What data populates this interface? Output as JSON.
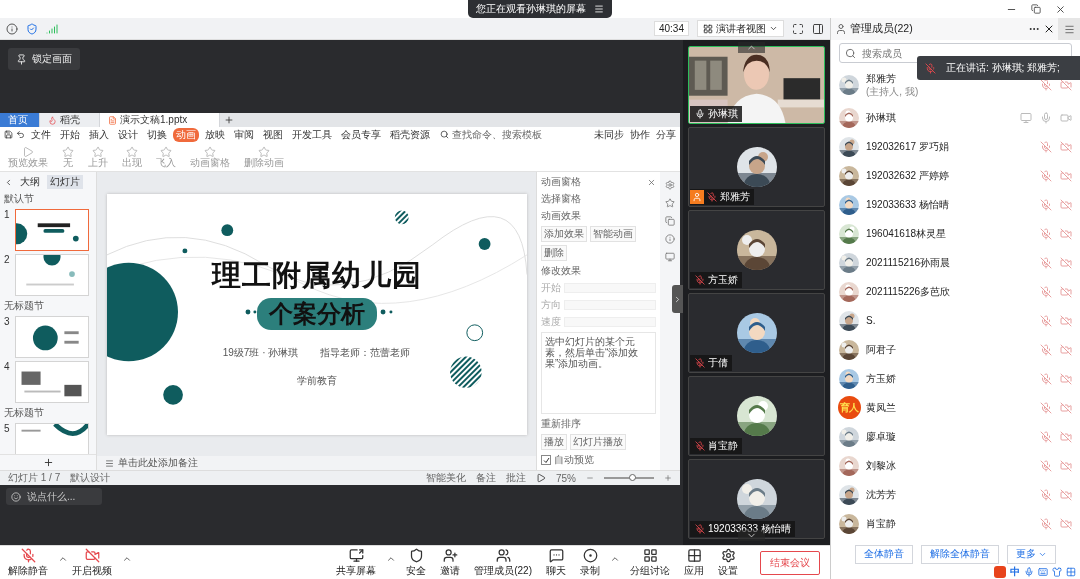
{
  "top_bar": {
    "title": "您正在观看孙琳琪的屏幕"
  },
  "meeting_bar": {
    "timer": "40:34",
    "view": "演讲者视图"
  },
  "lock_button": "锁定画面",
  "wps": {
    "tabs": [
      {
        "label": "首页",
        "kind": "home",
        "selected": false
      },
      {
        "label": "稻壳",
        "kind": "docer",
        "selected": false
      },
      {
        "label": "演示文稿1.pptx",
        "kind": "file",
        "selected": true
      }
    ],
    "menu": [
      {
        "label": "文件",
        "selected": false
      },
      {
        "label": "开始",
        "selected": false
      },
      {
        "label": "插入",
        "selected": false
      },
      {
        "label": "设计",
        "selected": false
      },
      {
        "label": "切换",
        "selected": false
      },
      {
        "label": "动画",
        "selected": true
      },
      {
        "label": "放映",
        "selected": false
      },
      {
        "label": "审阅",
        "selected": false
      },
      {
        "label": "视图",
        "selected": false
      },
      {
        "label": "开发工具",
        "selected": false
      },
      {
        "label": "会员专享",
        "selected": false
      },
      {
        "label": "稻壳资源",
        "selected": false
      }
    ],
    "search": "查找命令、搜索模板",
    "menu_actions": [
      "未同步",
      "协作",
      "分享"
    ],
    "ribbon": [
      "预览效果",
      "无",
      "上升",
      "出现",
      "飞入",
      "动画窗格",
      "删除动画"
    ],
    "panel_tabs": [
      {
        "label": "大纲",
        "selected": false
      },
      {
        "label": "幻灯片",
        "selected": true
      }
    ],
    "outline": [
      {
        "kind": "section",
        "label": "默认节"
      },
      {
        "kind": "slide",
        "number": "1",
        "selected": true
      },
      {
        "kind": "slide",
        "number": "2",
        "selected": false
      },
      {
        "kind": "section",
        "label": "无标题节"
      },
      {
        "kind": "slide",
        "number": "3",
        "selected": false
      },
      {
        "kind": "slide",
        "number": "4",
        "selected": false
      },
      {
        "kind": "section",
        "label": "无标题节"
      },
      {
        "kind": "slide",
        "number": "5",
        "selected": false
      }
    ],
    "slide": {
      "title": "理工附属幼儿园",
      "subtitle": "个案分析",
      "author": "19级7班 · 孙琳琪",
      "teacher": "指导老师：范蕾老师",
      "footer": "学前教育"
    },
    "notes_placeholder": "单击此处添加备注",
    "animation_pane": {
      "title": "动画窗格",
      "select_pane": "选择窗格",
      "effects": "动画效果",
      "buttons": [
        "添加效果",
        "智能动画",
        "删除"
      ],
      "modify": "修改效果",
      "fields": [
        "开始",
        "方向",
        "速度"
      ],
      "hint": "选中幻灯片的某个元素，然后单击“添加效果”添加动画。",
      "reorder": "重新排序",
      "play": "播放",
      "slideshow": "幻灯片播放",
      "autopreview": {
        "label": "自动预览",
        "checked": true
      }
    },
    "status": {
      "slide_count": "幻灯片 1 / 7",
      "theme": "默认设计",
      "beautify": "智能美化",
      "notes": "备注",
      "comments": "批注",
      "zoom": "75%",
      "level": 0.55
    }
  },
  "chat_placeholder": "说点什么...",
  "video_tiles": [
    {
      "name": "孙琳琪",
      "kind": "video",
      "speaking": true,
      "muted": false,
      "host": false
    },
    {
      "name": "郑雅芳",
      "kind": "avatar",
      "speaking": false,
      "muted": true,
      "host": true
    },
    {
      "name": "方玉娇",
      "kind": "avatar",
      "speaking": false,
      "muted": true,
      "host": false
    },
    {
      "name": "于倩",
      "kind": "avatar",
      "speaking": false,
      "muted": true,
      "host": false
    },
    {
      "name": "肖宝静",
      "kind": "avatar",
      "speaking": false,
      "muted": true,
      "host": false
    },
    {
      "name": "192033633 杨怡晴",
      "kind": "avatar",
      "speaking": false,
      "muted": true,
      "host": false
    }
  ],
  "panel": {
    "title": "管理成员(22)",
    "search_placeholder": "搜索成员",
    "speaking": "正在讲话: 孙琳琪; 郑雅芳;"
  },
  "participants": [
    {
      "name": "郑雅芳",
      "note": "(主持人, 我)",
      "sharing": false,
      "muted": true,
      "camera_on": false
    },
    {
      "name": "孙琳琪",
      "sharing": true,
      "muted": false,
      "camera_on": true
    },
    {
      "name": "192032617 罗巧娟",
      "sharing": false,
      "muted": true,
      "camera_on": false
    },
    {
      "name": "192032632 严婷婷",
      "sharing": false,
      "muted": true,
      "camera_on": false
    },
    {
      "name": "192033633 杨怡晴",
      "sharing": false,
      "muted": true,
      "camera_on": false
    },
    {
      "name": "196041618林灵星",
      "sharing": false,
      "muted": true,
      "camera_on": false
    },
    {
      "name": "2021115216孙雨晨",
      "sharing": false,
      "muted": true,
      "camera_on": false
    },
    {
      "name": "2021115226多芭欣",
      "sharing": false,
      "muted": true,
      "camera_on": false
    },
    {
      "name": "S.",
      "sharing": false,
      "muted": true,
      "camera_on": false
    },
    {
      "name": "阿君子",
      "sharing": false,
      "muted": true,
      "camera_on": false
    },
    {
      "name": "方玉娇",
      "sharing": false,
      "muted": true,
      "camera_on": false
    },
    {
      "name": "黄凤兰",
      "avatar": {
        "kind": "text",
        "text": "育人"
      },
      "sharing": false,
      "muted": true,
      "camera_on": false
    },
    {
      "name": "廖卓璇",
      "sharing": false,
      "muted": true,
      "camera_on": false
    },
    {
      "name": "刘黎冰",
      "sharing": false,
      "muted": true,
      "camera_on": false
    },
    {
      "name": "沈芳芳",
      "sharing": false,
      "muted": true,
      "camera_on": false
    },
    {
      "name": "肖宝静",
      "sharing": false,
      "muted": true,
      "camera_on": false
    }
  ],
  "panel_buttons": [
    "全体静音",
    "解除全体静音",
    "更多"
  ],
  "ime": {
    "mode": "中"
  },
  "media_controls": [
    {
      "label": "解除静音",
      "kind": "mic-off",
      "caret": true
    },
    {
      "label": "开启视频",
      "kind": "video-off",
      "caret": true
    }
  ],
  "toolbar": [
    {
      "label": "共享屏幕",
      "kind": "share",
      "caret": true
    },
    {
      "label": "安全",
      "kind": "security",
      "caret": false
    },
    {
      "label": "邀请",
      "kind": "invite",
      "caret": false
    },
    {
      "label": "管理成员(22)",
      "kind": "members",
      "caret": false
    },
    {
      "label": "聊天",
      "kind": "chat",
      "caret": false
    },
    {
      "label": "录制",
      "kind": "record",
      "caret": true
    },
    {
      "label": "分组讨论",
      "kind": "breakout",
      "caret": false
    },
    {
      "label": "应用",
      "kind": "apps",
      "caret": false
    },
    {
      "label": "设置",
      "kind": "settings",
      "caret": false
    }
  ],
  "end_button": "结束会议"
}
